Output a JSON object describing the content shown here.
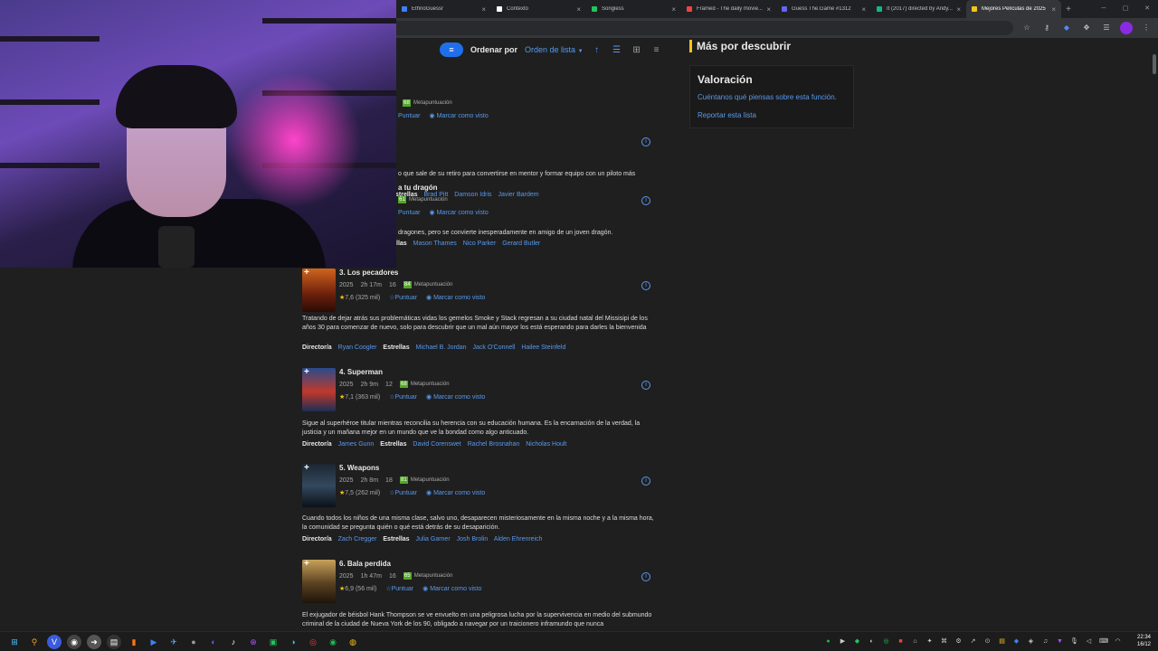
{
  "browser": {
    "tabs": [
      {
        "label": "EthnoGuessr",
        "favicon_color": "#3b82f6"
      },
      {
        "label": "Contexto",
        "favicon_color": "#ffffff"
      },
      {
        "label": "Songless",
        "favicon_color": "#22c55e"
      },
      {
        "label": "Framed - The daily movie...",
        "favicon_color": "#ef4444"
      },
      {
        "label": "Guess The.Game #1312",
        "favicon_color": "#6366f1"
      },
      {
        "label": "It (2017) directed by Andy...",
        "favicon_color": "#10b981"
      },
      {
        "label": "Mejores Películas de 2025",
        "favicon_color": "#f5c518"
      }
    ],
    "close_glyph": "×",
    "new_tab_glyph": "+"
  },
  "controls": {
    "sort_label": "Ordenar por",
    "sort_value": "Orden de lista"
  },
  "sidebar": {
    "title": "Más por descubrir",
    "rating_title": "Valoración",
    "feedback_link": "Cuéntanos qué piensas sobre esta función.",
    "report_link": "Reportar esta lista"
  },
  "labels": {
    "metascore": "Metapuntuación",
    "rate": "Puntuar",
    "watched": "Marcar como visto",
    "director": "Director/a",
    "stars": "Estrellas"
  },
  "movies": [
    {
      "title": "",
      "metascore": "68",
      "desc": "o que sale de su retiro para convertirse en mentor y formar equipo con un piloto más",
      "director": "",
      "stars": [
        "Brad Pitt",
        "Damson Idris",
        "Javier Bardem"
      ],
      "ms_color": "#54a72a"
    },
    {
      "title": "a tu dragón",
      "metascore": "61",
      "desc": "dragones, pero se convierte inesperadamente en amigo de un joven dragón.",
      "director": "",
      "stars": [
        "Mason Thames",
        "Nico Parker",
        "Gerard Butler"
      ],
      "ms_color": "#54a72a"
    },
    {
      "title": "3. Los pecadores",
      "year": "2025",
      "duration": "2h 17m",
      "age": "16",
      "metascore": "84",
      "rating": "7,6",
      "votes": "(325 mil)",
      "desc": "Tratando de dejar atrás sus problemáticas vidas los gemelos Smoke y Stack regresan a su ciudad natal del Missisipi de los años 30 para comenzar de nuevo, solo para descubrir que un mal aún mayor los está esperando para darles la bienvenida",
      "director": "Ryan Coogler",
      "stars": [
        "Michael B. Jordan",
        "Jack O'Connell",
        "Hailee Steinfeld"
      ],
      "ms_color": "#54a72a"
    },
    {
      "title": "4. Superman",
      "year": "2025",
      "duration": "2h 9m",
      "age": "12",
      "metascore": "68",
      "rating": "7,1",
      "votes": "(363 mil)",
      "desc": "Sigue al superhéroe titular mientras reconcilia su herencia con su educación humana. Es la encarnación de la verdad, la justicia y un mañana mejor en un mundo que ve la bondad como algo anticuado.",
      "director": "James Gunn",
      "stars": [
        "David Corenswet",
        "Rachel Brosnahan",
        "Nicholas Hoult"
      ],
      "ms_color": "#54a72a"
    },
    {
      "title": "5. Weapons",
      "year": "2025",
      "duration": "2h 8m",
      "age": "18",
      "metascore": "81",
      "rating": "7,5",
      "votes": "(262 mil)",
      "desc": "Cuando todos los niños de una misma clase, salvo uno, desaparecen misteriosamente en la misma noche y a la misma hora, la comunidad se pregunta quién o qué está detrás de su desaparición.",
      "director": "Zach Cregger",
      "stars": [
        "Julia Garner",
        "Josh Brolin",
        "Alden Ehrenreich"
      ],
      "ms_color": "#54a72a"
    },
    {
      "title": "6. Bala perdida",
      "year": "2025",
      "duration": "1h 47m",
      "age": "16",
      "metascore": "65",
      "rating": "6,9",
      "votes": "(56 mil)",
      "desc": "El exjugador de béisbol Hank Thompson se ve envuelto en una peligrosa lucha por la supervivencia en medio del submundo criminal de la ciudad de Nueva York de los 90, obligado a navegar por un traicionero inframundo que nunca",
      "director": "",
      "stars": [],
      "ms_color": "#54a72a"
    }
  ],
  "taskbar": {
    "time": "22:34",
    "date": "16/12"
  },
  "colors": {
    "accent_blue": "#5799ef",
    "imdb_yellow": "#f5c518",
    "metascore_green": "#54a72a"
  }
}
